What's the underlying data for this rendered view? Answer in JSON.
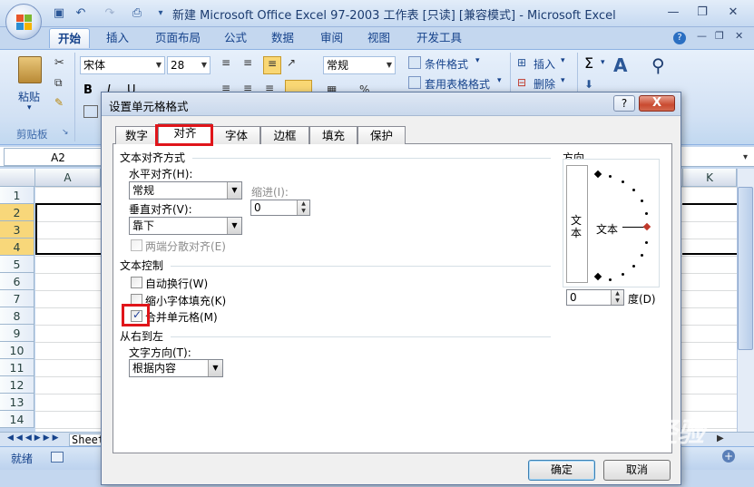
{
  "window": {
    "title": "新建 Microsoft Office Excel 97-2003 工作表 [只读] [兼容模式] - Microsoft Excel"
  },
  "ribbon": {
    "tabs": [
      "开始",
      "插入",
      "页面布局",
      "公式",
      "数据",
      "审阅",
      "视图",
      "开发工具"
    ],
    "paste_label": "粘贴",
    "clipboard_label": "剪贴板",
    "font_name": "宋体",
    "font_size": "28",
    "number_format": "常规",
    "conditional_format": "条件格式",
    "table_format": "套用表格格式",
    "insert_label": "插入",
    "delete_label": "删除"
  },
  "sheet": {
    "name_box": "A2",
    "col_a": "A",
    "col_k": "K",
    "rows": [
      "1",
      "2",
      "3",
      "4",
      "5",
      "6",
      "7",
      "8",
      "9",
      "10",
      "11",
      "12",
      "13",
      "14"
    ],
    "sheet_tab": "Sheet",
    "status": "就绪"
  },
  "dialog": {
    "title": "设置单元格格式",
    "help": "?",
    "close": "X",
    "tabs": [
      "数字",
      "对齐",
      "字体",
      "边框",
      "填充",
      "保护"
    ],
    "active_tab": "对齐",
    "text_align_section": "文本对齐方式",
    "horizontal_label": "水平对齐(H):",
    "horizontal_value": "常规",
    "indent_label": "缩进(I):",
    "indent_value": "0",
    "vertical_label": "垂直对齐(V):",
    "vertical_value": "靠下",
    "distributed_label": "两端分散对齐(E)",
    "text_control_section": "文本控制",
    "wrap_label": "自动换行(W)",
    "wrap_checked": false,
    "shrink_label": "缩小字体填充(K)",
    "shrink_checked": false,
    "merge_label": "合并单元格(M)",
    "merge_checked": true,
    "rtl_section": "从右到左",
    "direction_label": "文字方向(T):",
    "direction_value": "根据内容",
    "orientation_label": "方向",
    "vertical_text": "文本",
    "orientation_text": "文本",
    "degree_value": "0",
    "degree_label": "度(D)",
    "ok": "确定",
    "cancel": "取消"
  },
  "watermark": "Baidu经验"
}
